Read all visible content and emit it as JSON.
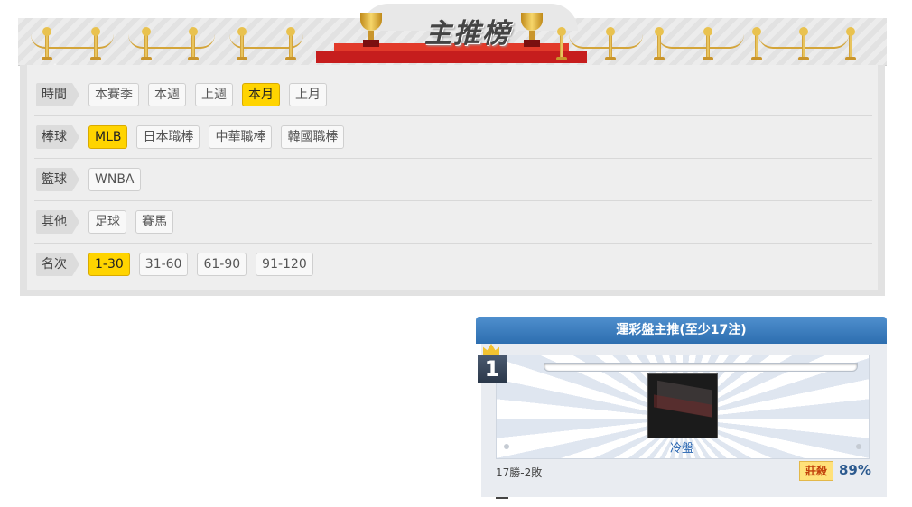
{
  "banner": {
    "title": "主推榜"
  },
  "filters": [
    {
      "label": "時間",
      "options": [
        "本賽季",
        "本週",
        "上週",
        "本月",
        "上月"
      ],
      "active": 3
    },
    {
      "label": "棒球",
      "options": [
        "MLB",
        "日本職棒",
        "中華職棒",
        "韓國職棒"
      ],
      "active": 0
    },
    {
      "label": "籃球",
      "options": [
        "WNBA"
      ],
      "active": -1
    },
    {
      "label": "其他",
      "options": [
        "足球",
        "賽馬"
      ],
      "active": -1
    },
    {
      "label": "名次",
      "options": [
        "1-30",
        "31-60",
        "61-90",
        "91-120"
      ],
      "active": 0
    }
  ],
  "ranking": {
    "header": "運彩盤主推(至少17注)",
    "rank": "1",
    "player_name": "冷盤",
    "record": "17勝-2敗",
    "tag": "莊殺",
    "percent": "89%"
  }
}
